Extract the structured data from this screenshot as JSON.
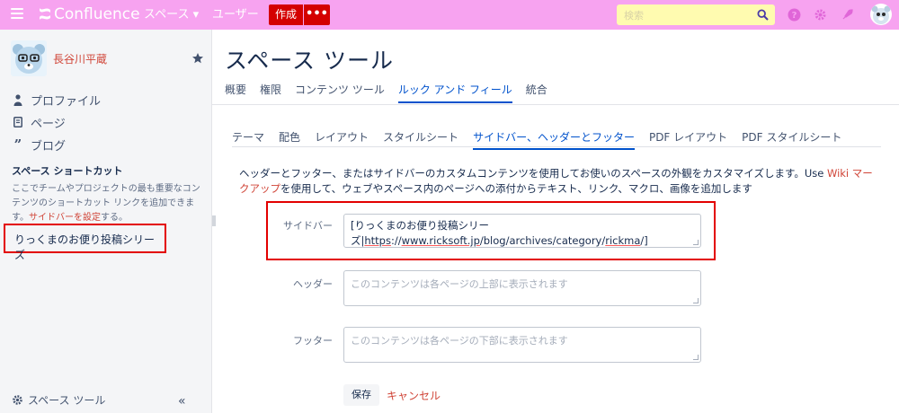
{
  "topbar": {
    "logo": "Confluence",
    "nav": {
      "spaces": "スペース",
      "users": "ユーザー"
    },
    "create": "作成",
    "more": "•••",
    "search_placeholder": "検索",
    "colors": {
      "bar": "#f7a3f0",
      "create": "#d40000",
      "search_bg": "#fffbb0"
    }
  },
  "sidebar": {
    "space_name": "長谷川平蔵",
    "links": [
      {
        "label": "プロファイル",
        "icon": "person-icon"
      },
      {
        "label": "ページ",
        "icon": "page-icon"
      },
      {
        "label": "ブログ",
        "icon": "quote-icon"
      }
    ],
    "shortcuts_heading": "スペース ショートカット",
    "shortcuts_desc": "ここでチームやプロジェクトの最も重要なコンテンツのショートカット リンクを追加できます。",
    "shortcuts_link": "サイドバーを設定",
    "shortcuts_suffix": "する。",
    "shortcut_item": "りっくまのお便り投稿シリーズ",
    "space_tools": "スペース ツール",
    "collapse": "«"
  },
  "main": {
    "title": "スペース ツール",
    "tabs": [
      "概要",
      "権限",
      "コンテンツ ツール",
      "ルック アンド フィール",
      "統合"
    ],
    "active_tab": 3,
    "subtabs": [
      "テーマ",
      "配色",
      "レイアウト",
      "スタイルシート",
      "サイドバー、ヘッダーとフッター",
      "PDF レイアウト",
      "PDF スタイルシート"
    ],
    "active_subtab": 4,
    "intro": {
      "part1": "ヘッダーとフッター、またはサイドバーのカスタムコンテンツを使用してお使いのスペースの外観をカスタマイズします。Use ",
      "link": "Wiki マークアップ",
      "part2": "を使用して、ウェブやスペース内のページへの添付からテキスト、リンク、マクロ、画像を追加します"
    },
    "form": {
      "sidebar_label": "サイドバー",
      "sidebar_value_line1": "[りっくまのお便り投稿シリー",
      "sidebar_value_line2_prefix": "ズ|",
      "sidebar_value_url_a": "https",
      "sidebar_value_url_b": "://",
      "sidebar_value_url_c": "www.ricksoft.jp",
      "sidebar_value_url_d": "/blog/archives/category/",
      "sidebar_value_url_e": "rickma",
      "sidebar_value_url_f": "/]",
      "header_label": "ヘッダー",
      "header_placeholder": "このコンテンツは各ページの上部に表示されます",
      "footer_label": "フッター",
      "footer_placeholder": "このコンテンツは各ページの下部に表示されます",
      "save": "保存",
      "cancel": "キャンセル"
    }
  }
}
